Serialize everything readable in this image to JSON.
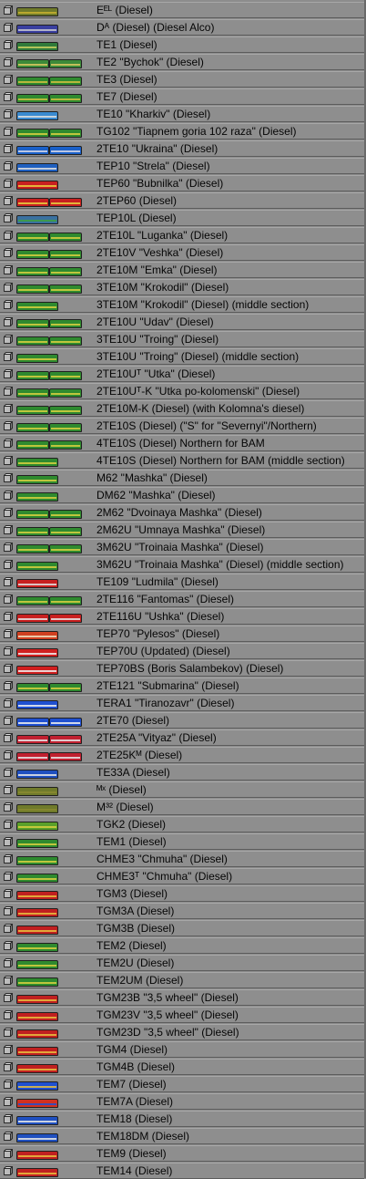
{
  "list_items": [
    {
      "label": "Eᴱᴸ (Diesel)",
      "colors": [
        "#6f7a2a"
      ],
      "cars": 1,
      "stripe": "#c8b030"
    },
    {
      "label": "Dᴬ (Diesel) (Diesel Alco)",
      "colors": [
        "#3a3fa0"
      ],
      "cars": 1,
      "stripe": "#c8c8d0"
    },
    {
      "label": "TE1 (Diesel)",
      "colors": [
        "#2f7a3a"
      ],
      "cars": 1,
      "stripe": "#c8d060"
    },
    {
      "label": "TE2 \"Bychok\" (Diesel)",
      "colors": [
        "#3c8a3a",
        "#3c8a3a"
      ],
      "cars": 2,
      "stripe": "#d8c860"
    },
    {
      "label": "TE3 (Diesel)",
      "colors": [
        "#2f8a2f",
        "#2f8a2f"
      ],
      "cars": 2,
      "stripe": "#d0c040"
    },
    {
      "label": "TE7 (Diesel)",
      "colors": [
        "#2f8a2f",
        "#2f8a2f"
      ],
      "cars": 2,
      "stripe": "#d0c040"
    },
    {
      "label": "TE10 \"Kharkiv\" (Diesel)",
      "colors": [
        "#3a8ad0"
      ],
      "cars": 1,
      "stripe": "#e0e0e0"
    },
    {
      "label": "TG102 \"Tiapnem goria 102 raza\" (Diesel)",
      "colors": [
        "#2f8a2f",
        "#2f8a2f"
      ],
      "cars": 2,
      "stripe": "#d8d040"
    },
    {
      "label": "2TE10 \"Ukraina\" (Diesel)",
      "colors": [
        "#1a60c8",
        "#1a60c8"
      ],
      "cars": 2,
      "stripe": "#d8d8e8"
    },
    {
      "label": "TEP10 \"Strela\" (Diesel)",
      "colors": [
        "#2060c0"
      ],
      "cars": 1,
      "stripe": "#e0e0e0"
    },
    {
      "label": "TEP60 \"Bubnilka\" (Diesel)",
      "colors": [
        "#c82020"
      ],
      "cars": 1,
      "stripe": "#e8d040"
    },
    {
      "label": "2TEP60 (Diesel)",
      "colors": [
        "#c82020",
        "#c82020"
      ],
      "cars": 2,
      "stripe": "#e8d040"
    },
    {
      "label": "TEP10L (Diesel)",
      "colors": [
        "#3a70a0"
      ],
      "cars": 1,
      "stripe": "#40a040"
    },
    {
      "label": "2TE10L \"Luganka\" (Diesel)",
      "colors": [
        "#2f8a2f",
        "#2f8a2f"
      ],
      "cars": 2,
      "stripe": "#d8d040"
    },
    {
      "label": "2TE10V \"Veshka\" (Diesel)",
      "colors": [
        "#2f8a2f",
        "#2f8a2f"
      ],
      "cars": 2,
      "stripe": "#d8d040"
    },
    {
      "label": "2TE10M \"Emka\" (Diesel)",
      "colors": [
        "#2f8a2f",
        "#2f8a2f"
      ],
      "cars": 2,
      "stripe": "#d8d040"
    },
    {
      "label": "3TE10M \"Krokodil\" (Diesel)",
      "colors": [
        "#2f8a2f",
        "#2f8a2f"
      ],
      "cars": 2,
      "stripe": "#d8d040"
    },
    {
      "label": "3TE10M \"Krokodil\" (Diesel) (middle section)",
      "colors": [
        "#2f8a2f"
      ],
      "cars": 1,
      "stripe": "#d8d040"
    },
    {
      "label": "2TE10U \"Udav\" (Diesel)",
      "colors": [
        "#2f8a2f",
        "#2f8a2f"
      ],
      "cars": 2,
      "stripe": "#d8d040"
    },
    {
      "label": "3TE10U \"Troing\" (Diesel)",
      "colors": [
        "#2f8a2f",
        "#2f8a2f"
      ],
      "cars": 2,
      "stripe": "#d8d040"
    },
    {
      "label": "3TE10U \"Troing\" (Diesel) (middle section)",
      "colors": [
        "#2f8a2f"
      ],
      "cars": 1,
      "stripe": "#d8d040"
    },
    {
      "label": "2TE10Uᵀ \"Utka\" (Diesel)",
      "colors": [
        "#2f8a2f",
        "#2f8a2f"
      ],
      "cars": 2,
      "stripe": "#d8d040"
    },
    {
      "label": "2TE10Uᵀ-K \"Utka po-kolomenski\" (Diesel)",
      "colors": [
        "#2f8a2f",
        "#2f8a2f"
      ],
      "cars": 2,
      "stripe": "#d8d040"
    },
    {
      "label": "2TE10M-K (Diesel) (with Kolomna's diesel)",
      "colors": [
        "#2f8a2f",
        "#2f8a2f"
      ],
      "cars": 2,
      "stripe": "#d8d040"
    },
    {
      "label": "2TE10S (Diesel) (\"S\" for \"Severnyi\"/Northern)",
      "colors": [
        "#2f8a2f",
        "#2f8a2f"
      ],
      "cars": 2,
      "stripe": "#d8d040"
    },
    {
      "label": "4TE10S (Diesel) Northern for BAM",
      "colors": [
        "#2f8a2f",
        "#2f8a2f"
      ],
      "cars": 2,
      "stripe": "#d8d040"
    },
    {
      "label": "4TE10S (Diesel) Northern for BAM (middle section)",
      "colors": [
        "#2f8a2f"
      ],
      "cars": 1,
      "stripe": "#d8d040"
    },
    {
      "label": "M62 \"Mashka\" (Diesel)",
      "colors": [
        "#2f8a2f"
      ],
      "cars": 1,
      "stripe": "#d8d040"
    },
    {
      "label": "DM62 \"Mashka\" (Diesel)",
      "colors": [
        "#2f8a2f"
      ],
      "cars": 1,
      "stripe": "#d8d040"
    },
    {
      "label": "2M62 \"Dvoinaya Mashka\" (Diesel)",
      "colors": [
        "#2f8a2f",
        "#2f8a2f"
      ],
      "cars": 2,
      "stripe": "#d8d040"
    },
    {
      "label": "2M62U \"Umnaya Mashka\" (Diesel)",
      "colors": [
        "#2f8a2f",
        "#2f8a2f"
      ],
      "cars": 2,
      "stripe": "#d8d040"
    },
    {
      "label": "3M62U \"Troinaia Mashka\" (Diesel)",
      "colors": [
        "#2f8a2f",
        "#2f8a2f"
      ],
      "cars": 2,
      "stripe": "#d8d040"
    },
    {
      "label": "3M62U \"Troinaia Mashka\" (Diesel) (middle section)",
      "colors": [
        "#2f8a2f"
      ],
      "cars": 1,
      "stripe": "#d8d040"
    },
    {
      "label": "TE109 \"Ludmila\" (Diesel)",
      "colors": [
        "#c82020"
      ],
      "cars": 1,
      "stripe": "#e0e0e0"
    },
    {
      "label": "2TE116 \"Fantomas\" (Diesel)",
      "colors": [
        "#2f8a2f",
        "#2f8a2f"
      ],
      "cars": 2,
      "stripe": "#d8d040"
    },
    {
      "label": "2TE116U \"Ushka\" (Diesel)",
      "colors": [
        "#c82020",
        "#c82020"
      ],
      "cars": 2,
      "stripe": "#e8e8e8"
    },
    {
      "label": "TEP70 \"Pylesos\" (Diesel)",
      "colors": [
        "#d04020"
      ],
      "cars": 1,
      "stripe": "#f0e0c0"
    },
    {
      "label": "TEP70U (Updated) (Diesel)",
      "colors": [
        "#d02020"
      ],
      "cars": 1,
      "stripe": "#f0f0f0"
    },
    {
      "label": "TEP70BS (Boris Salambekov) (Diesel)",
      "colors": [
        "#d02020"
      ],
      "cars": 1,
      "stripe": "#f0f0f0"
    },
    {
      "label": "2TE121 \"Submarina\" (Diesel)",
      "colors": [
        "#2f8a2f",
        "#2f8a2f"
      ],
      "cars": 2,
      "stripe": "#d8d040"
    },
    {
      "label": "TERA1 \"Tiranozavr\" (Diesel)",
      "colors": [
        "#2050d0"
      ],
      "cars": 1,
      "stripe": "#f0f0f0"
    },
    {
      "label": "2TE70 (Diesel)",
      "colors": [
        "#2050d0",
        "#2050d0"
      ],
      "cars": 2,
      "stripe": "#f0f0f0"
    },
    {
      "label": "2TE25A \"Vityaz\" (Diesel)",
      "colors": [
        "#c02030",
        "#c02030"
      ],
      "cars": 2,
      "stripe": "#e8e8e8"
    },
    {
      "label": "2TE25Kᴹ (Diesel)",
      "colors": [
        "#c02030",
        "#c02030"
      ],
      "cars": 2,
      "stripe": "#e8e8e8"
    },
    {
      "label": "TE33A (Diesel)",
      "colors": [
        "#2050c0"
      ],
      "cars": 1,
      "stripe": "#e8e8e8"
    },
    {
      "label": "ᴹˣ (Diesel)",
      "colors": [
        "#6f7a2a"
      ],
      "cars": 1,
      "stripe": "#8a8a30"
    },
    {
      "label": "M³² (Diesel)",
      "colors": [
        "#6f7a2a"
      ],
      "cars": 1,
      "stripe": "#8a8a30"
    },
    {
      "label": "TGK2 (Diesel)",
      "colors": [
        "#5aa02a"
      ],
      "cars": 1,
      "stripe": "#d8d040"
    },
    {
      "label": "TEM1 (Diesel)",
      "colors": [
        "#2f8a2f"
      ],
      "cars": 1,
      "stripe": "#d8d040"
    },
    {
      "label": "CHME3 \"Chmuha\" (Diesel)",
      "colors": [
        "#2f8a2f"
      ],
      "cars": 1,
      "stripe": "#d8d040"
    },
    {
      "label": "CHME3ᵀ \"Chmuha\" (Diesel)",
      "colors": [
        "#2f8a2f"
      ],
      "cars": 1,
      "stripe": "#d8d040"
    },
    {
      "label": "TGM3 (Diesel)",
      "colors": [
        "#c02020"
      ],
      "cars": 1,
      "stripe": "#e8c040"
    },
    {
      "label": "TGM3A (Diesel)",
      "colors": [
        "#c02020"
      ],
      "cars": 1,
      "stripe": "#e8c040"
    },
    {
      "label": "TGM3B (Diesel)",
      "colors": [
        "#c02020"
      ],
      "cars": 1,
      "stripe": "#e8c040"
    },
    {
      "label": "TEM2 (Diesel)",
      "colors": [
        "#2f8a2f"
      ],
      "cars": 1,
      "stripe": "#d8d040"
    },
    {
      "label": "TEM2U (Diesel)",
      "colors": [
        "#2f8a2f"
      ],
      "cars": 1,
      "stripe": "#d8d040"
    },
    {
      "label": "TEM2UM (Diesel)",
      "colors": [
        "#2f8a2f"
      ],
      "cars": 1,
      "stripe": "#d8d040"
    },
    {
      "label": "TGM23B \"3,5 wheel\" (Diesel)",
      "colors": [
        "#c02020"
      ],
      "cars": 1,
      "stripe": "#e8c040"
    },
    {
      "label": "TGM23V \"3,5 wheel\" (Diesel)",
      "colors": [
        "#c02020"
      ],
      "cars": 1,
      "stripe": "#e8c040"
    },
    {
      "label": "TGM23D \"3,5 wheel\" (Diesel)",
      "colors": [
        "#c02020"
      ],
      "cars": 1,
      "stripe": "#e8c040"
    },
    {
      "label": "TGM4 (Diesel)",
      "colors": [
        "#c02020"
      ],
      "cars": 1,
      "stripe": "#e8c040"
    },
    {
      "label": "TGM4B (Diesel)",
      "colors": [
        "#c02020"
      ],
      "cars": 1,
      "stripe": "#e8c040"
    },
    {
      "label": "TEM7 (Diesel)",
      "colors": [
        "#2050d0"
      ],
      "cars": 1,
      "stripe": "#e8c040"
    },
    {
      "label": "TEM7A (Diesel)",
      "colors": [
        "#d03020"
      ],
      "cars": 1,
      "stripe": "#2050d0"
    },
    {
      "label": "TEM18 (Diesel)",
      "colors": [
        "#2050c0"
      ],
      "cars": 1,
      "stripe": "#e8e8e8"
    },
    {
      "label": "TEM18DM (Diesel)",
      "colors": [
        "#2050c0"
      ],
      "cars": 1,
      "stripe": "#e8e8e8"
    },
    {
      "label": "TEM9 (Diesel)",
      "colors": [
        "#c02020"
      ],
      "cars": 1,
      "stripe": "#e8c040"
    },
    {
      "label": "TEM14 (Diesel)",
      "colors": [
        "#c02020"
      ],
      "cars": 1,
      "stripe": "#e8c040"
    }
  ]
}
